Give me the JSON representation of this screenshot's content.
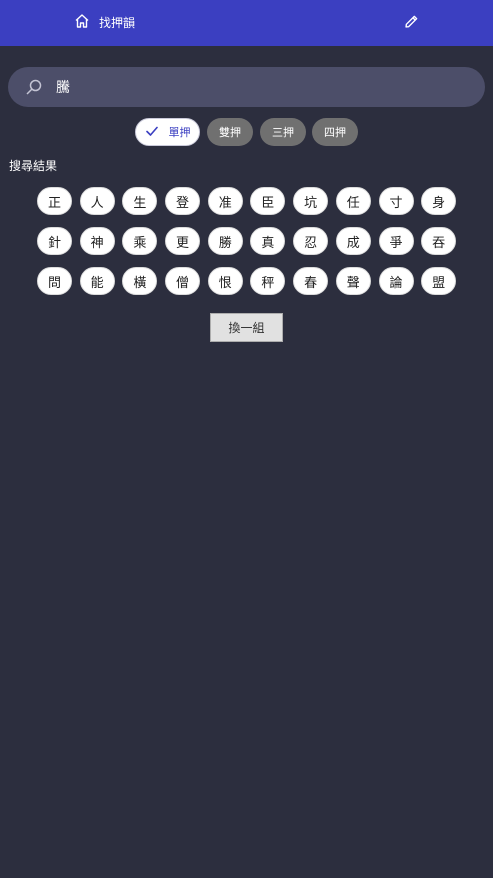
{
  "header": {
    "title": "找押韻",
    "home_icon": "home-icon",
    "edit_icon": "pencil-icon",
    "background": "#3b3fc1"
  },
  "search": {
    "value": "騰",
    "icon": "search-icon"
  },
  "filters": [
    {
      "label": "單押",
      "selected": true
    },
    {
      "label": "雙押",
      "selected": false
    },
    {
      "label": "三押",
      "selected": false
    },
    {
      "label": "四押",
      "selected": false
    }
  ],
  "results_label": "搜尋結果",
  "results": [
    [
      "正",
      "人",
      "生",
      "登",
      "准",
      "臣",
      "坑",
      "任",
      "寸",
      "身"
    ],
    [
      "針",
      "神",
      "乘",
      "更",
      "勝",
      "真",
      "忍",
      "成",
      "爭",
      "吞"
    ],
    [
      "問",
      "能",
      "橫",
      "僧",
      "恨",
      "秤",
      "春",
      "聲",
      "論",
      "盟"
    ]
  ],
  "refresh_label": "換一組",
  "colors": {
    "background": "#2c2e3e",
    "search_bg": "#4c4e69",
    "chip_unselected": "#707070",
    "chip_selected_text": "#3b3fc1"
  }
}
